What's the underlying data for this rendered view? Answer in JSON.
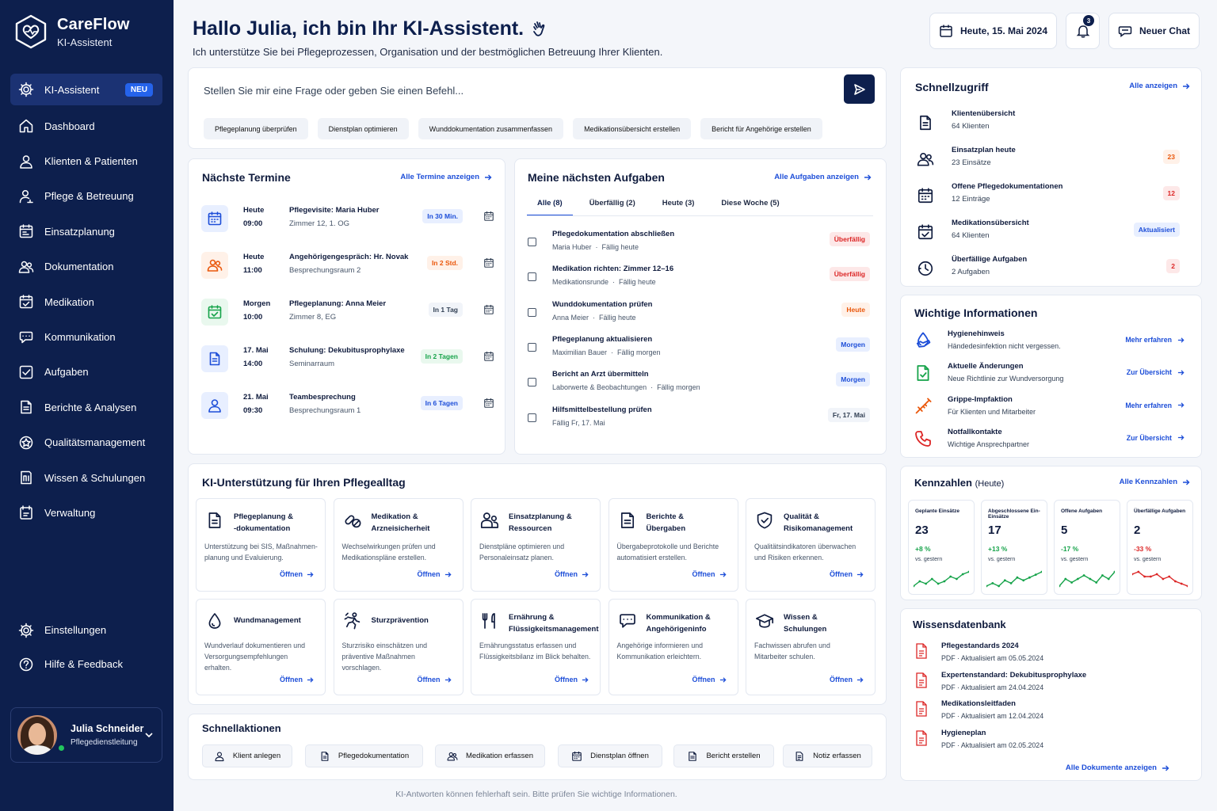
{
  "app": {
    "name": "CareFlow",
    "subtitle": "KI-Assistent"
  },
  "sidebar": {
    "items": [
      {
        "label": "KI-Assistent",
        "icon": "gear-icon",
        "badge": "NEU",
        "active": true
      },
      {
        "label": "Dashboard",
        "icon": "home-icon"
      },
      {
        "label": "Klienten & Patienten",
        "icon": "user-icon"
      },
      {
        "label": "Pflege & Betreuung",
        "icon": "user-care-icon"
      },
      {
        "label": "Einsatzplanung",
        "icon": "calendar-edit-icon"
      },
      {
        "label": "Dokumentation",
        "icon": "users-icon"
      },
      {
        "label": "Medikation",
        "icon": "calendar-check-icon"
      },
      {
        "label": "Kommunikation",
        "icon": "chat-icon"
      },
      {
        "label": "Aufgaben",
        "icon": "checkbox-icon"
      },
      {
        "label": "Berichte & Analysen",
        "icon": "report-icon"
      },
      {
        "label": "Qualitätsmanagement",
        "icon": "quality-icon"
      },
      {
        "label": "Wissen & Schulungen",
        "icon": "book-icon"
      },
      {
        "label": "Verwaltung",
        "icon": "folder-icon"
      }
    ],
    "bottom": [
      {
        "label": "Einstellungen",
        "icon": "gear-icon"
      },
      {
        "label": "Hilfe & Feedback",
        "icon": "help-icon"
      }
    ],
    "user": {
      "name": "Julia Schneider",
      "role": "Pflegedienstleitung"
    }
  },
  "header": {
    "title": "Hallo Julia, ich bin Ihr KI-Assistent.",
    "subtitle": "Ich unterstütze Sie bei Pflegeprozessen, Organisation und der bestmöglichen Betreuung Ihrer Klienten.",
    "date": "Heute, 15. Mai 2024",
    "notifications": "3",
    "new_chat": "Neuer Chat"
  },
  "chat": {
    "placeholder": "Stellen Sie mir eine Frage oder geben Sie einen Befehl...",
    "suggestions": [
      "Pflegeplanung überprüfen",
      "Dienstplan optimieren",
      "Wunddokumentation zusammenfassen",
      "Medikationsübersicht erstellen",
      "Bericht für Angehörige erstellen"
    ]
  },
  "termine": {
    "title": "Nächste Termine",
    "link": "Alle Termine anzeigen",
    "items": [
      {
        "day": "Heute",
        "time": "09:00",
        "title": "Pflegevisite: Maria Huber",
        "loc": "Zimmer 12, 1. OG",
        "badge": "In 30 Min.",
        "color": "#1d4ed8",
        "bg": "#e8efff",
        "badge_color": "#1d4ed8",
        "badge_bg": "#e8efff"
      },
      {
        "day": "Heute",
        "time": "11:00",
        "title": "Angehörigengespräch: Hr. Novak",
        "loc": "Besprechungsraum 2",
        "badge": "In 2 Std.",
        "color": "#ea580c",
        "bg": "#fff1e8",
        "badge_color": "#ea580c",
        "badge_bg": "#fff1e8"
      },
      {
        "day": "Morgen",
        "time": "10:00",
        "title": "Pflegeplanung: Anna Meier",
        "loc": "Zimmer 8, EG",
        "badge": "In 1 Tag",
        "color": "#16a34a",
        "bg": "#e9f8ee",
        "badge_color": "#334155",
        "badge_bg": "#f1f4f9"
      },
      {
        "day": "17. Mai",
        "time": "14:00",
        "title": "Schulung: Dekubitusprophylaxe",
        "loc": "Seminarraum",
        "badge": "In 2 Tagen",
        "color": "#1d4ed8",
        "bg": "#e8efff",
        "badge_color": "#16a34a",
        "badge_bg": "#e9f8ee"
      },
      {
        "day": "21. Mai",
        "time": "09:30",
        "title": "Teambesprechung",
        "loc": "Besprechungsraum 1",
        "badge": "In 6 Tagen",
        "color": "#1d4ed8",
        "bg": "#e8efff",
        "badge_color": "#1d4ed8",
        "badge_bg": "#e8efff"
      }
    ]
  },
  "aufgaben": {
    "title": "Meine nächsten Aufgaben",
    "link": "Alle Aufgaben anzeigen",
    "tabs": [
      "Alle (8)",
      "Überfällig (2)",
      "Heute (3)",
      "Diese Woche (5)"
    ],
    "items": [
      {
        "title": "Pflegedokumentation abschließen",
        "who": "Maria Huber",
        "due": "Fällig heute",
        "badge": "Überfällig",
        "badge_color": "#dc2626",
        "badge_bg": "#fde8e8"
      },
      {
        "title": "Medikation richten: Zimmer 12–16",
        "who": "Medikationsrunde",
        "due": "Fällig heute",
        "badge": "Überfällig",
        "badge_color": "#dc2626",
        "badge_bg": "#fde8e8"
      },
      {
        "title": "Wunddokumentation prüfen",
        "who": "Anna Meier",
        "due": "Fällig heute",
        "badge": "Heute",
        "badge_color": "#ea580c",
        "badge_bg": "#fff1e8"
      },
      {
        "title": "Pflegeplanung aktualisieren",
        "who": "Maximilian Bauer",
        "due": "Fällig morgen",
        "badge": "Morgen",
        "badge_color": "#1d4ed8",
        "badge_bg": "#e8efff"
      },
      {
        "title": "Bericht an Arzt übermitteln",
        "who": "Laborwerte & Beobachtungen",
        "due": "Fällig morgen",
        "badge": "Morgen",
        "badge_color": "#1d4ed8",
        "badge_bg": "#e8efff"
      },
      {
        "title": "Hilfsmittelbestellung prüfen",
        "who": "",
        "due": "Fällig Fr, 17. Mai",
        "badge": "Fr, 17. Mai",
        "badge_color": "#334155",
        "badge_bg": "#f1f4f9"
      }
    ]
  },
  "ki": {
    "title": "KI-Unterstützung für Ihren Pflegealltag",
    "open": "Öffnen",
    "cards": [
      {
        "title1": "Pflegeplanung &",
        "title2": "-dokumentation",
        "desc1": "Unterstützung bei SIS, Maßnahmen-",
        "desc2": "planung und Evaluierung.",
        "desc3": "",
        "icon": "document-icon"
      },
      {
        "title1": "Medikation &",
        "title2": "Arzneisicherheit",
        "desc1": "Wechselwirkungen prüfen und",
        "desc2": "Medikationspläne erstellen.",
        "desc3": "",
        "icon": "pills-icon"
      },
      {
        "title1": "Einsatzplanung &",
        "title2": "Ressourcen",
        "desc1": "Dienstpläne optimieren und",
        "desc2": "Personaleinsatz planen.",
        "desc3": "",
        "icon": "team-icon"
      },
      {
        "title1": "Berichte &",
        "title2": "Übergaben",
        "desc1": "Übergabeprotokolle und Berichte",
        "desc2": "automatisiert erstellen.",
        "desc3": "",
        "icon": "report-icon"
      },
      {
        "title1": "Qualität &",
        "title2": "Risikomanagement",
        "desc1": "Qualitätsindikatoren überwachen",
        "desc2": "und Risiken erkennen.",
        "desc3": "",
        "icon": "shield-icon"
      },
      {
        "title1": "Wundmanagement",
        "title2": "",
        "desc1": "Wundverlauf dokumentieren und",
        "desc2": "Versorgungsempfehlungen",
        "desc3": "erhalten.",
        "icon": "drop-icon"
      },
      {
        "title1": "Sturzprävention",
        "title2": "",
        "desc1": "Sturzrisiko einschätzen und",
        "desc2": "präventive Maßnahmen",
        "desc3": "vorschlagen.",
        "icon": "fall-icon"
      },
      {
        "title1": "Ernährung &",
        "title2": "Flüssigkeitsmanagement",
        "desc1": "Ernährungsstatus erfassen und",
        "desc2": "Flüssigkeitsbilanz im Blick behalten.",
        "desc3": "",
        "icon": "utensils-icon"
      },
      {
        "title1": "Kommunikation &",
        "title2": "Angehörigeninfo",
        "desc1": "Angehörige informieren und",
        "desc2": "Kommunikation erleichtern.",
        "desc3": "",
        "icon": "chat-icon"
      },
      {
        "title1": "Wissen &",
        "title2": "Schulungen",
        "desc1": "Fachwissen abrufen und",
        "desc2": "Mitarbeiter schulen.",
        "desc3": "",
        "icon": "graduation-icon"
      }
    ]
  },
  "schnellaktionen": {
    "title": "Schnellaktionen",
    "items": [
      {
        "label": "Klient anlegen",
        "icon": "user-icon"
      },
      {
        "label": "Pflegedokumentation",
        "icon": "document-icon"
      },
      {
        "label": "Medikation erfassen",
        "icon": "users-icon"
      },
      {
        "label": "Dienstplan öffnen",
        "icon": "calendar-icon"
      },
      {
        "label": "Bericht erstellen",
        "icon": "report-icon"
      },
      {
        "label": "Notiz erfassen",
        "icon": "note-icon"
      }
    ]
  },
  "schnellzugriff": {
    "title": "Schnellzugriff",
    "link": "Alle anzeigen",
    "items": [
      {
        "title": "Klientenübersicht",
        "sub": "64 Klienten",
        "badge": "",
        "icon": "document-icon",
        "badge_color": "",
        "badge_bg": ""
      },
      {
        "title": "Einsatzplan heute",
        "sub": "23 Einsätze",
        "badge": "23",
        "icon": "users-icon",
        "badge_color": "#ea580c",
        "badge_bg": "#fff1e8"
      },
      {
        "title": "Offene Pflegedokumentationen",
        "sub": "12 Einträge",
        "badge": "12",
        "icon": "calendar-icon",
        "badge_color": "#dc2626",
        "badge_bg": "#fde8e8"
      },
      {
        "title": "Medikationsübersicht",
        "sub": "64 Klienten",
        "badge": "Aktualisiert",
        "icon": "calendar-check-icon",
        "badge_color": "#1d4ed8",
        "badge_bg": "#e8efff"
      },
      {
        "title": "Überfällige Aufgaben",
        "sub": "2 Aufgaben",
        "badge": "2",
        "icon": "clock-icon",
        "badge_color": "#dc2626",
        "badge_bg": "#fde8e8"
      }
    ]
  },
  "infos": {
    "title": "Wichtige Informationen",
    "items": [
      {
        "title": "Hygienehinweis",
        "sub": "Händedesinfektion nicht vergessen.",
        "link": "Mehr erfahren",
        "icon": "hygiene-icon",
        "color": "#1d4ed8"
      },
      {
        "title": "Aktuelle Änderungen",
        "sub": "Neue Richtlinie zur Wundversorgung",
        "link": "Zur Übersicht",
        "icon": "document-change-icon",
        "color": "#16a34a"
      },
      {
        "title": "Grippe-Impfaktion",
        "sub": "Für Klienten und Mitarbeiter",
        "link": "Mehr erfahren",
        "icon": "syringe-icon",
        "color": "#ea580c"
      },
      {
        "title": "Notfallkontakte",
        "sub": "Wichtige Ansprechpartner",
        "link": "Zur Übersicht",
        "icon": "phone-icon",
        "color": "#dc2626"
      }
    ]
  },
  "kennzahlen": {
    "title": "Kennzahlen",
    "title_suffix": "(Heute)",
    "link": "Alle Kennzahlen",
    "items": [
      {
        "label": "Geplante Einsätze",
        "value": "23",
        "change": "+8 %",
        "cmp": "vs. gestern",
        "color": "#16a34a",
        "trend": [
          3,
          5,
          4,
          6,
          4,
          5,
          7,
          6,
          8,
          9
        ]
      },
      {
        "label": "Abgeschlossene Ein-Einsätze",
        "value": "17",
        "change": "+13 %",
        "cmp": "vs. gestern",
        "color": "#16a34a",
        "trend": [
          3,
          4,
          3,
          5,
          4,
          6,
          5,
          6,
          7,
          8
        ]
      },
      {
        "label": "Offene Aufgaben",
        "value": "5",
        "change": "-17 %",
        "cmp": "vs. gestern",
        "color": "#16a34a",
        "trend": [
          3,
          5,
          4,
          5,
          6,
          5,
          4,
          6,
          5,
          7
        ]
      },
      {
        "label": "Überfällige Aufgaben",
        "value": "2",
        "change": "-33 %",
        "cmp": "vs. gestern",
        "color": "#dc2626",
        "trend": [
          7,
          8,
          6,
          6,
          7,
          5,
          6,
          4,
          3,
          2
        ]
      }
    ]
  },
  "wissen": {
    "title": "Wissensdatenbank",
    "link": "Alle Dokumente anzeigen",
    "items": [
      {
        "title": "Pflegestandards 2024",
        "meta": "PDF  ·  Aktualisiert am 05.05.2024"
      },
      {
        "title": "Expertenstandard: Dekubitusprophylaxe",
        "meta": "PDF  ·  Aktualisiert am 24.04.2024"
      },
      {
        "title": "Medikationsleitfaden",
        "meta": "PDF  ·  Aktualisiert am 12.04.2024"
      },
      {
        "title": "Hygieneplan",
        "meta": "PDF  ·  Aktualisiert am 02.05.2024"
      }
    ]
  },
  "footer": "KI-Antworten können fehlerhaft sein. Bitte prüfen Sie wichtige Informationen.",
  "colors": {
    "sidebar": "#0d1f4d",
    "accent": "#1d4ed8",
    "success": "#16a34a",
    "danger": "#dc2626",
    "warning": "#ea580c"
  }
}
